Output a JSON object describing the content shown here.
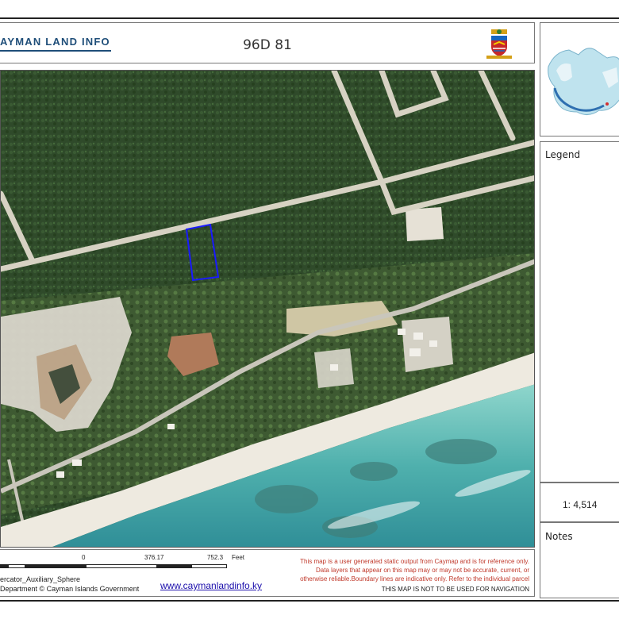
{
  "header": {
    "logo_text": "AYMAN LAND INFO",
    "parcel_title": "96D 81"
  },
  "map": {
    "parcel_outline_color": "#1a1aff",
    "land_color": "#2f4a2a",
    "sea_color": "#5fb8b0"
  },
  "footer": {
    "scale_ticks": [
      "0",
      "376.17",
      "752.3"
    ],
    "scale_unit": "Feet",
    "projection": "ercator_Auxiliary_Sphere",
    "copyright": "Department © Cayman Islands Government",
    "url": "www.caymanlandinfo.ky",
    "disclaimer": "This map is a user generated static output from Caymap and is for reference only. Data layers that appear on this map may or may not be accurate, current, or otherwise reliable.Boundary lines are indicative only. Refer to the individual parcel",
    "navigation_warning": "THIS MAP IS NOT TO BE USED FOR NAVIGATION"
  },
  "sidebar": {
    "legend_title": "Legend",
    "scale_text": "1: 4,514",
    "notes_title": "Notes"
  }
}
